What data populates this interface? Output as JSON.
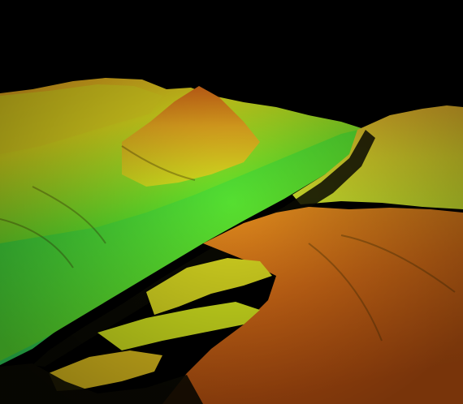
{
  "scene": {
    "kind": "3D lidar elevation terrain render",
    "palette": {
      "sky": "#000000",
      "low": "#1bd64a",
      "low_mid": "#6fe32c",
      "mid": "#cfe01c",
      "high": "#e6a21c",
      "highest": "#c85a12",
      "shadow": "#0c0a02"
    }
  }
}
